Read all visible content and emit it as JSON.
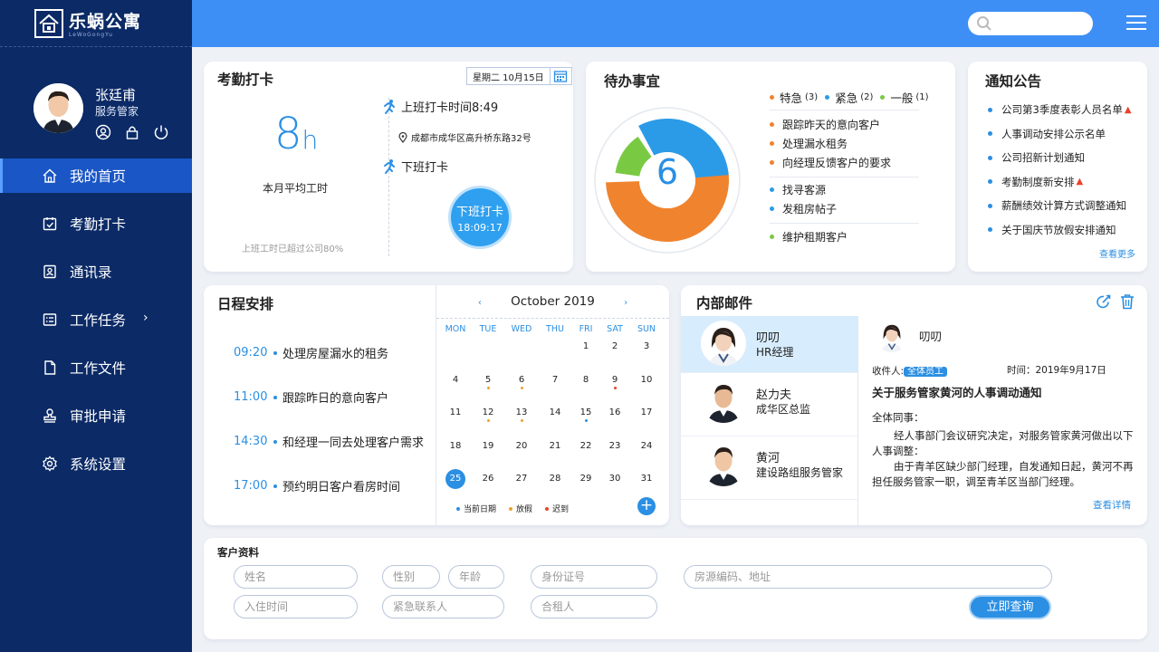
{
  "brand": {
    "name": "乐蜗公寓",
    "sub": "LeWoGongYu"
  },
  "user": {
    "name": "张廷甫",
    "role": "服务管家"
  },
  "nav": [
    {
      "label": "我的首页",
      "icon": "home-icon",
      "active": true
    },
    {
      "label": "考勤打卡",
      "icon": "calendar-check-icon"
    },
    {
      "label": "通讯录",
      "icon": "contacts-icon"
    },
    {
      "label": "工作任务",
      "icon": "task-list-icon",
      "has_arrow": true,
      "arrow": "›"
    },
    {
      "label": "工作文件",
      "icon": "file-icon"
    },
    {
      "label": "审批申请",
      "icon": "stamp-icon"
    },
    {
      "label": "系统设置",
      "icon": "gear-icon"
    }
  ],
  "attendance": {
    "title": "考勤打卡",
    "date": "星期二   10月15日",
    "hours_value": "8",
    "hours_unit": "h",
    "hours_label": "本月平均工时",
    "note": "上班工时已超过公司80%",
    "checkin": "上班打卡时间8:49",
    "address": "成都市成华区高升桥东路32号",
    "checkout": "下班打卡",
    "button_label": "下班打卡",
    "button_time": "18:09:17"
  },
  "todo": {
    "title": "待办事宜",
    "count": "6",
    "legend": [
      {
        "label": "特急",
        "count": "(3)",
        "color": "#f0832e"
      },
      {
        "label": "紧急",
        "count": "(2)",
        "color": "#2b9be8"
      },
      {
        "label": "一般",
        "count": "(1)",
        "color": "#7ac943"
      }
    ],
    "urgent": [
      "跟踪昨天的意向客户",
      "处理漏水租务",
      "向经理反馈客户的要求"
    ],
    "important": [
      "找寻客源",
      "发租房帖子"
    ],
    "normal": [
      "维护租期客户"
    ],
    "donut": {
      "orange": 3,
      "blue": 2,
      "green": 1
    }
  },
  "notice": {
    "title": "通知公告",
    "items": [
      {
        "text": "公司第3季度表彰人员名单",
        "hot": true
      },
      {
        "text": "人事调动安排公示名单",
        "hot": false
      },
      {
        "text": "公司招新计划通知",
        "hot": false
      },
      {
        "text": "考勤制度新安排",
        "hot": true
      },
      {
        "text": "薪酬绩效计算方式调整通知",
        "hot": false
      },
      {
        "text": "关于国庆节放假安排通知",
        "hot": false
      }
    ],
    "more": "查看更多"
  },
  "schedule": {
    "title": "日程安排",
    "items": [
      {
        "time": "09:20",
        "text": "处理房屋漏水的租务"
      },
      {
        "time": "11:00",
        "text": "跟踪昨日的意向客户"
      },
      {
        "time": "14:30",
        "text": "和经理一同去处理客户需求"
      },
      {
        "time": "17:00",
        "text": "预约明日客户看房时间"
      }
    ]
  },
  "calendar": {
    "month_label": "October  2019",
    "prev": "‹",
    "next": "›",
    "weekdays": [
      "MON",
      "TUE",
      "WED",
      "THU",
      "FRI",
      "SAT",
      "SUN"
    ],
    "first_weekday": 1,
    "days": 31,
    "today": 25,
    "marks": {
      "5": "#f0a030",
      "6": "#f0a030",
      "9": "#e8442a",
      "12": "#f0a030",
      "13": "#f0a030",
      "15": "#2b8fe3"
    },
    "legend": [
      {
        "label": "当前日期",
        "color": "#2b8fe3"
      },
      {
        "label": "放假",
        "color": "#f0a030"
      },
      {
        "label": "迟到",
        "color": "#e8442a"
      }
    ],
    "add": "+"
  },
  "mail": {
    "title": "内部邮件",
    "list": [
      {
        "name": "叨叨",
        "role": "HR经理",
        "selected": true,
        "gender": "f"
      },
      {
        "name": "赵力夫",
        "role": "成华区总监",
        "selected": false,
        "gender": "m"
      },
      {
        "name": "黄河",
        "role": "建设路组服务管家",
        "selected": false,
        "gender": "m"
      }
    ],
    "detail": {
      "from": "叨叨",
      "to_label": "收件人:",
      "to_tag": "全体员工",
      "time": "时间：2019年9月17日",
      "subject": "关于服务管家黄河的人事调动通知",
      "greeting": "全体同事：",
      "para1": "经人事部门会议研究决定，对服务管家黄河做出以下人事调整：",
      "para2": "由于青羊区缺少部门经理，自发通知日起，黄河不再担任服务管家一职，调至青羊区当部门经理。",
      "more": "查看详情"
    }
  },
  "customer": {
    "title": "客户资料",
    "fields": {
      "name": "姓名",
      "gender": "性别",
      "age": "年龄",
      "id": "身份证号",
      "house": "房源编码、地址",
      "checkin": "入住时间",
      "contact": "紧急联系人",
      "roommate": "合租人"
    },
    "query": "立即查询"
  },
  "colors": {
    "sidebar": "#0b2a66",
    "accent": "#2b8fe3",
    "header": "#3d8ff5"
  }
}
